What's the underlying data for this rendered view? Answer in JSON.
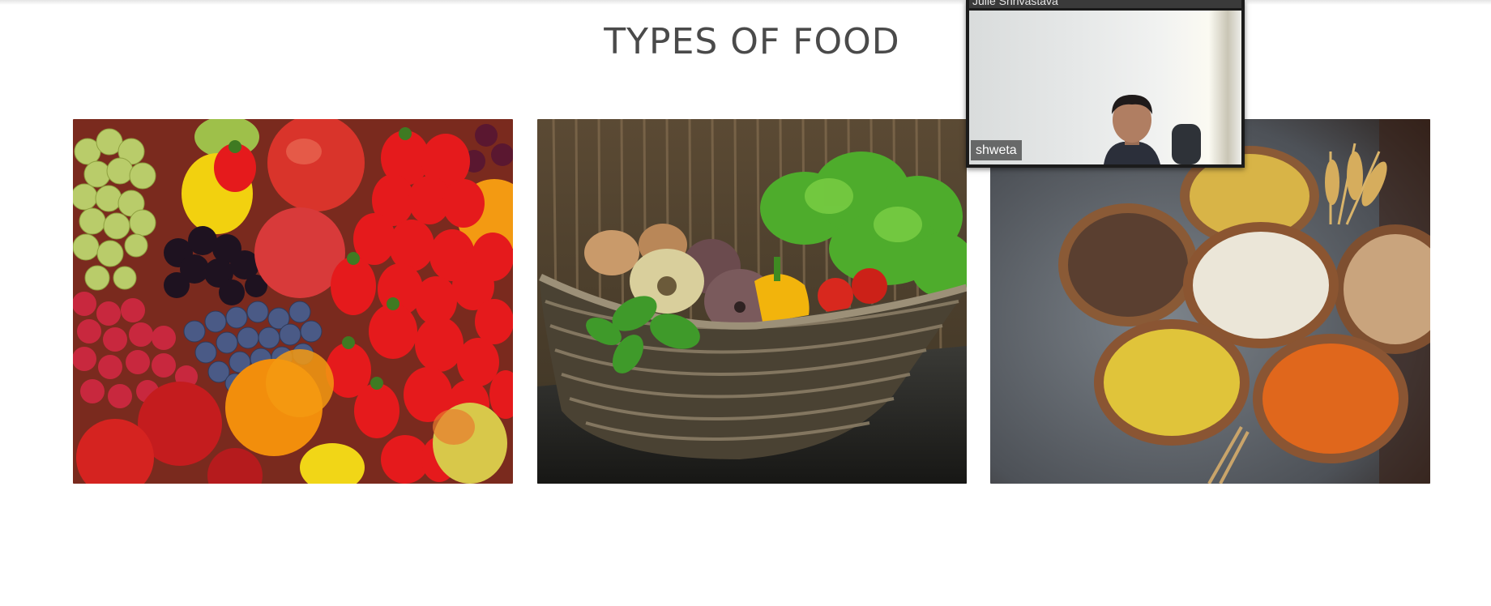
{
  "page": {
    "title": "TYPES OF FOOD"
  },
  "gallery": {
    "images": [
      {
        "subject": "fresh fruits"
      },
      {
        "subject": "vegetables in wicker basket"
      },
      {
        "subject": "grains and pulses in wooden bowls"
      }
    ]
  },
  "video_call": {
    "top_participant": "Julie Shrivastava",
    "main_participant": "shweta"
  },
  "colors": {
    "title": "#4a4a4a",
    "overlay_frame": "#1b1b1b"
  }
}
